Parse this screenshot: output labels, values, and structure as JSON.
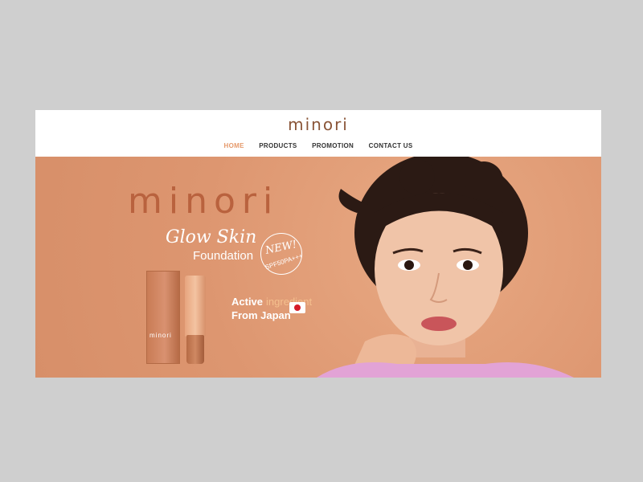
{
  "header": {
    "logo": "minori",
    "nav": [
      {
        "label": "HOME",
        "active": true
      },
      {
        "label": "PRODUCTS",
        "active": false
      },
      {
        "label": "PROMOTION",
        "active": false
      },
      {
        "label": "CONTACT US",
        "active": false
      }
    ]
  },
  "hero": {
    "brand": "minori",
    "headline": "Glow Skin",
    "subheadline": "Foundation",
    "badge": "NEW!",
    "spf": "SPF50PA+++",
    "active_label": "Active",
    "ingredient_label": "ingredient",
    "from_label": "From Japan",
    "product_box_label": "minori"
  },
  "colors": {
    "brand": "#8a5538",
    "hero_bg": "#e19e76",
    "nav_active": "#e69a6c",
    "brand_big": "#b9623e"
  }
}
